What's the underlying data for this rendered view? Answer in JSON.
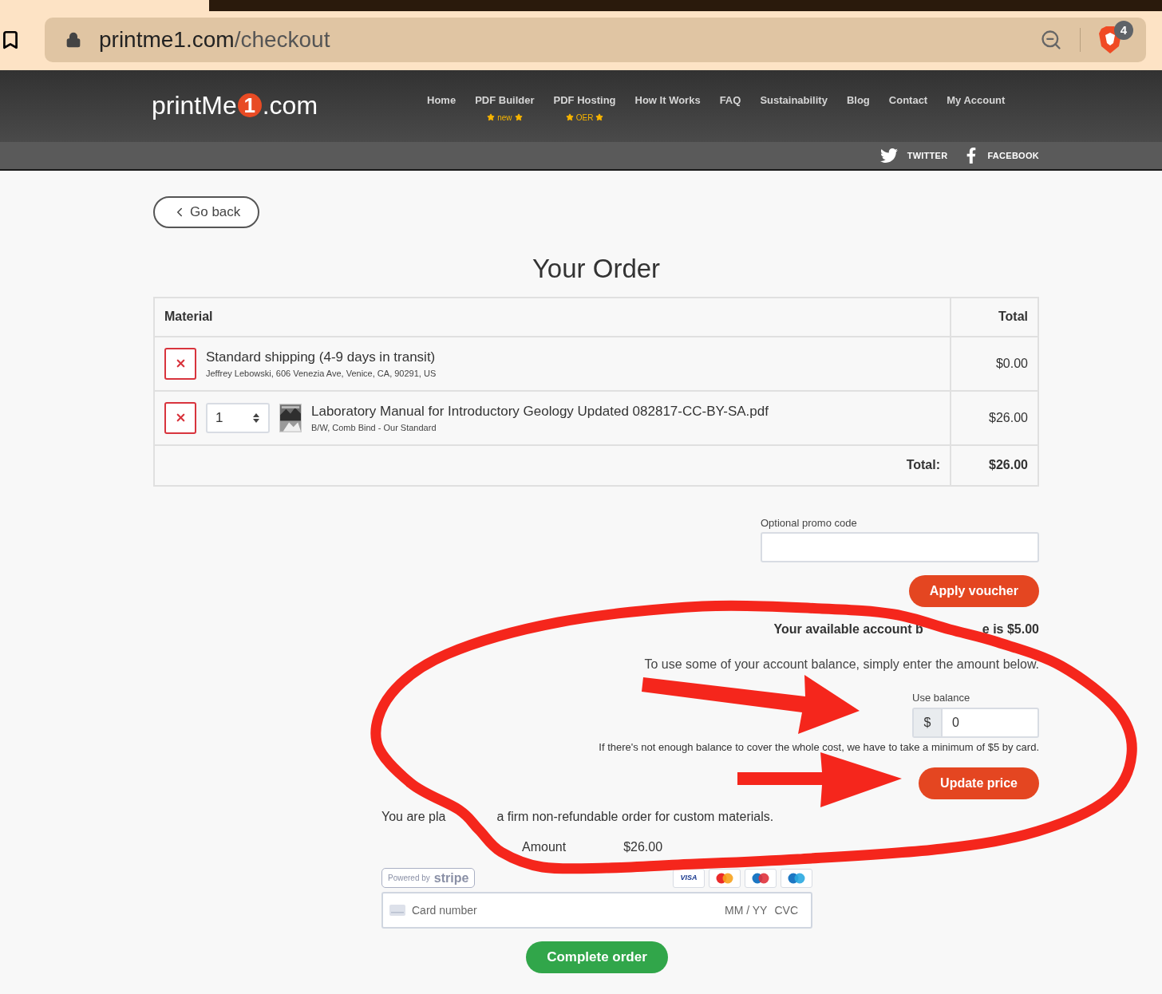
{
  "browser": {
    "url_host": "printme1.com",
    "url_path": "/checkout",
    "shield_badge": "4"
  },
  "header": {
    "logo": {
      "text_before": "printMe",
      "digit": "1",
      "text_after": ".com"
    },
    "nav": [
      {
        "label": "Home"
      },
      {
        "label": "PDF Builder",
        "badge": "new"
      },
      {
        "label": "PDF Hosting",
        "badge": "OER"
      },
      {
        "label": "How It Works"
      },
      {
        "label": "FAQ"
      },
      {
        "label": "Sustainability"
      },
      {
        "label": "Blog"
      },
      {
        "label": "Contact"
      },
      {
        "label": "My Account"
      }
    ],
    "social": [
      {
        "kind": "twitter",
        "label": "TWITTER"
      },
      {
        "kind": "facebook",
        "label": "FACEBOOK"
      }
    ]
  },
  "back_button": "Go back",
  "title": "Your Order",
  "table": {
    "columns": [
      "Material",
      "Total"
    ],
    "rows": [
      {
        "kind": "shipping",
        "title": "Standard shipping (4-9 days in transit)",
        "subtitle": "Jeffrey Lebowski, 606 Venezia Ave, Venice, CA, 90291, US",
        "total": "$0.00"
      },
      {
        "kind": "item",
        "quantity": "1",
        "title": "Laboratory Manual for Introductory Geology Updated 082817-CC-BY-SA.pdf",
        "subtitle": "B/W, Comb Bind - Our Standard",
        "total": "$26.00"
      }
    ],
    "footer": {
      "label": "Total:",
      "value": "$26.00"
    }
  },
  "promo": {
    "label": "Optional promo code",
    "button": "Apply voucher"
  },
  "balance": {
    "available_parts": [
      "Your available account b",
      "e is $5.00"
    ],
    "instruction": "To use some of your account balance, simply enter the amount below.",
    "field_label": "Use balance",
    "prefix": "$",
    "value": "0",
    "note": "If there's not enough balance to cover the whole cost, we have to take a minimum of $5 by card.",
    "button": "Update price"
  },
  "order_notice_parts": [
    "You are pla",
    "a firm non-refundable order for custom materials."
  ],
  "amount_parts": [
    "Amount",
    "$26.00"
  ],
  "payment": {
    "powered_by": "Powered by",
    "brand": "stripe",
    "cards": [
      {
        "kind": "visa",
        "label": "VISA"
      },
      {
        "kind": "mastercard"
      },
      {
        "kind": "maestro"
      },
      {
        "kind": "cirrus"
      }
    ],
    "card_placeholder": "Card number",
    "expiry_placeholder": "MM / YY",
    "cvc_placeholder": "CVC",
    "button": "Complete order"
  }
}
